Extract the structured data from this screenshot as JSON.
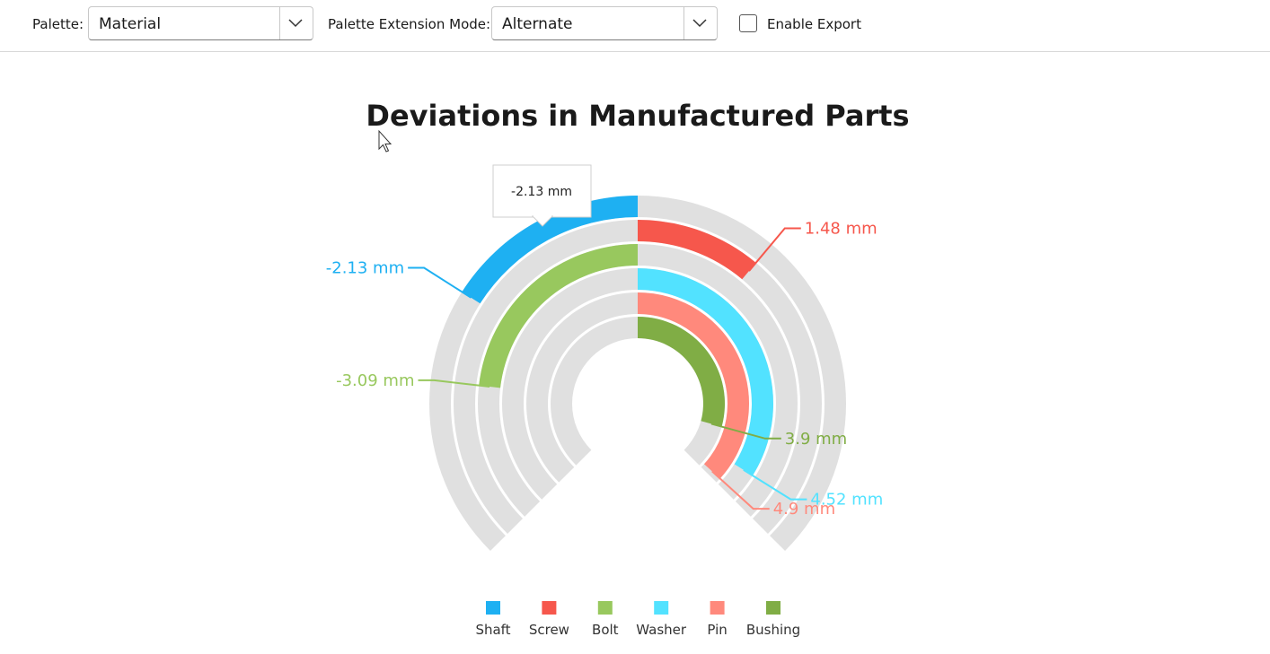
{
  "toolbar": {
    "palette_label": "Palette:",
    "palette_value": "Material",
    "ext_label": "Palette Extension Mode:",
    "ext_value": "Alternate",
    "export_label": "Enable Export",
    "export_checked": false
  },
  "chart_data": {
    "type": "radial-bar",
    "title": "Deviations in Manufactured Parts",
    "unit": "mm",
    "max_abs": 5,
    "series": [
      {
        "name": "Shaft",
        "value": -2.13,
        "label": "-2.13 mm",
        "color": "#1EB0F2"
      },
      {
        "name": "Screw",
        "value": 1.48,
        "label": "1.48 mm",
        "color": "#F6574C"
      },
      {
        "name": "Bolt",
        "value": -3.09,
        "label": "-3.09 mm",
        "color": "#98C85E"
      },
      {
        "name": "Washer",
        "value": 4.52,
        "label": "4.52 mm",
        "color": "#52E2FF"
      },
      {
        "name": "Pin",
        "value": 4.9,
        "label": "4.9 mm",
        "color": "#FF897C"
      },
      {
        "name": "Bushing",
        "value": 3.9,
        "label": "3.9 mm",
        "color": "#80AD45"
      }
    ],
    "tooltip": "-2.13 mm",
    "legend_position": "bottom",
    "track_color": "#E0E0E0"
  }
}
